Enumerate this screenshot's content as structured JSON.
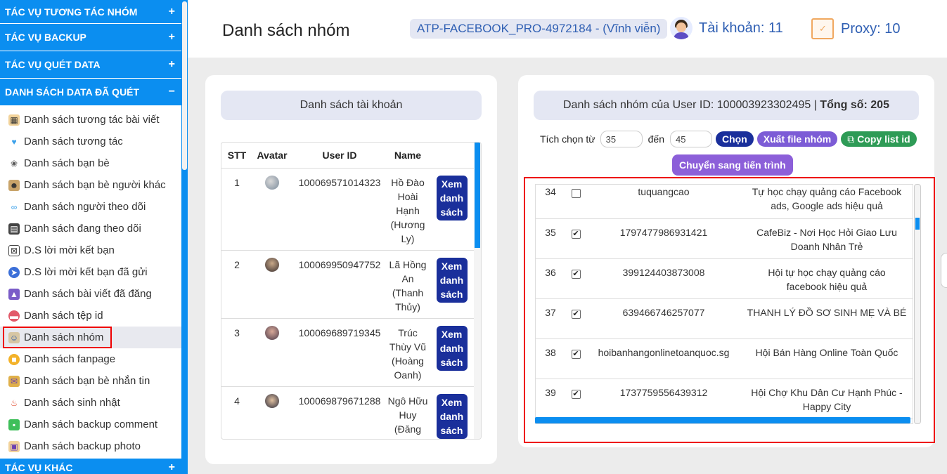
{
  "sidebar": {
    "sections": [
      {
        "label": "TÁC VỤ TƯƠNG TÁC NHÓM",
        "sign": "+"
      },
      {
        "label": "TÁC VỤ BACKUP",
        "sign": "+"
      },
      {
        "label": "TÁC VỤ QUÉT DATA",
        "sign": "+"
      },
      {
        "label": "DANH SÁCH DATA ĐÃ QUÉT",
        "sign": "−"
      }
    ],
    "items": [
      {
        "label": "Danh sách tương tác bài viết",
        "icon": "interaction-icon"
      },
      {
        "label": "Danh sách tương tác",
        "icon": "heart-icon"
      },
      {
        "label": "Danh sách bạn bè",
        "icon": "friends-icon"
      },
      {
        "label": "Danh sách bạn bè người khác",
        "icon": "group-people-icon"
      },
      {
        "label": "Danh sách người theo dõi",
        "icon": "followers-icon"
      },
      {
        "label": "Danh sách đang theo dõi",
        "icon": "following-icon"
      },
      {
        "label": "D.S lời mời kết bạn",
        "icon": "friend-request-icon"
      },
      {
        "label": "D.S lời mời kết bạn đã gửi",
        "icon": "sent-icon"
      },
      {
        "label": "Danh sách bài viết đã đăng",
        "icon": "post-icon"
      },
      {
        "label": "Danh sách tệp id",
        "icon": "id-file-icon"
      },
      {
        "label": "Danh sách nhóm",
        "icon": "group-icon"
      },
      {
        "label": "Danh sách fanpage",
        "icon": "fanpage-icon"
      },
      {
        "label": "Danh sách bạn bè nhắn tin",
        "icon": "message-icon"
      },
      {
        "label": "Danh sách sinh nhật",
        "icon": "birthday-icon"
      },
      {
        "label": "Danh sách backup comment",
        "icon": "comment-icon"
      },
      {
        "label": "Danh sách backup photo",
        "icon": "photo-icon"
      }
    ],
    "bottom_section": {
      "label": "TÁC VỤ KHÁC",
      "sign": "+"
    }
  },
  "header": {
    "title": "Danh sách nhóm",
    "license": "ATP-FACEBOOK_PRO-4972184 - (Vĩnh viễn)",
    "accounts": "Tài khoản: 11",
    "proxy": "Proxy: 10"
  },
  "accounts_panel": {
    "heading": "Danh sách tài khoản",
    "columns": [
      "STT",
      "Avatar",
      "User ID",
      "Name"
    ],
    "view_label": "Xem danh sách",
    "rows": [
      {
        "stt": "1",
        "user_id": "100069571014323",
        "name": "Hồ Đào Hoài Hạnh (Hương Ly)"
      },
      {
        "stt": "2",
        "user_id": "100069950947752",
        "name": "Lã Hồng An (Thanh Thủy)"
      },
      {
        "stt": "3",
        "user_id": "100069689719345",
        "name": "Trúc Thùy Vũ (Hoàng Oanh)"
      },
      {
        "stt": "4",
        "user_id": "100069879671288",
        "name": "Ngô Hữu Huy (Đăng"
      }
    ]
  },
  "groups_panel": {
    "heading_prefix": "Danh sách nhóm của User ID: 100003923302495 | ",
    "heading_total": "Tổng số: 205",
    "select_from_label": "Tích chọn từ",
    "from_value": "35",
    "to_label": "đến",
    "to_value": "45",
    "choose_label": "Chọn",
    "export_label": "Xuất file nhóm",
    "copy_label": "Copy list id",
    "transfer_label": "Chuyển sang tiến trình",
    "rows": [
      {
        "no": "34",
        "checked": false,
        "uid": "tuquangcao",
        "name": "Tự học chạy quảng cáo Facebook ads, Google ads hiệu quả"
      },
      {
        "no": "35",
        "checked": true,
        "uid": "1797477986931421",
        "name": "CafeBiz - Nơi Học Hỏi Giao Lưu Doanh Nhân Trẻ"
      },
      {
        "no": "36",
        "checked": true,
        "uid": "399124403873008",
        "name": "Hội tự học chạy quảng cáo facebook hiệu quả"
      },
      {
        "no": "37",
        "checked": true,
        "uid": "639466746257077",
        "name": "THANH LÝ ĐỒ SƠ SINH MẸ VÀ BÉ"
      },
      {
        "no": "38",
        "checked": true,
        "uid": "hoibanhangonlinetoanquoc.sg",
        "name": "Hội Bán Hàng Online Toàn Quốc"
      },
      {
        "no": "39",
        "checked": true,
        "uid": "1737759556439312",
        "name": "Hội Chợ Khu Dân Cư Hạnh Phúc - Happy City"
      }
    ]
  },
  "colors": {
    "sidebar_blue": "#0b8ef0",
    "navy": "#1a2f9b",
    "purple": "#7c5cd6",
    "green": "#2e9b56",
    "highlight_red": "#ee0000"
  }
}
